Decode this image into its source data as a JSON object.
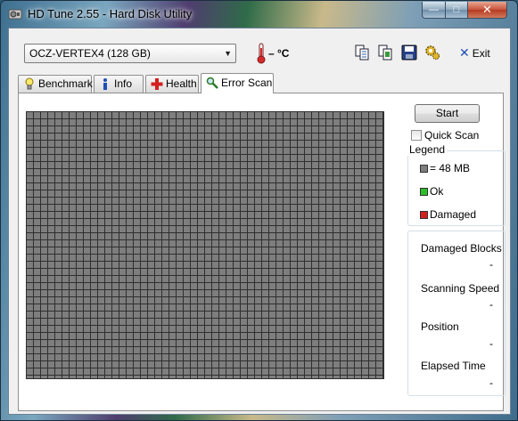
{
  "window": {
    "title": "HD Tune 2.55 - Hard Disk Utility",
    "min_glyph": "—",
    "max_glyph": "□",
    "close_glyph": "✕"
  },
  "toolbar": {
    "drive": "OCZ-VERTEX4 (128 GB)",
    "temperature": "– °C",
    "exit_label": "Exit",
    "exit_glyph": "✕"
  },
  "tabs": [
    {
      "label": "Benchmark",
      "icon": "lightbulb-icon",
      "active": false
    },
    {
      "label": "Info",
      "icon": "info-icon",
      "active": false
    },
    {
      "label": "Health",
      "icon": "health-cross-icon",
      "active": false
    },
    {
      "label": "Error Scan",
      "icon": "magnifier-icon",
      "active": true
    }
  ],
  "error_scan": {
    "start_label": "Start",
    "quick_scan_label": "Quick Scan",
    "quick_scan_checked": false,
    "legend": {
      "title": "Legend",
      "items": [
        {
          "label": "= 48 MB",
          "color": "#7e7e7e"
        },
        {
          "label": "Ok",
          "color": "#2bbf2b"
        },
        {
          "label": "Damaged",
          "color": "#d42020"
        }
      ]
    },
    "stats": [
      {
        "label": "Damaged Blocks",
        "value": "-"
      },
      {
        "label": "Scanning Speed",
        "value": "-"
      },
      {
        "label": "Position",
        "value": "-"
      },
      {
        "label": "Elapsed Time",
        "value": "-"
      }
    ]
  }
}
